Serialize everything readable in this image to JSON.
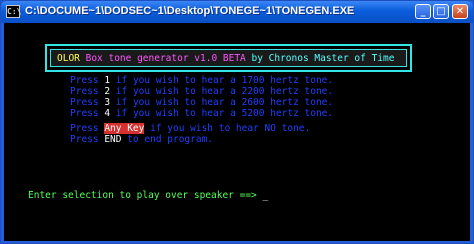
{
  "window": {
    "title": "C:\\DOCUME~1\\DODSEC~1\\Desktop\\TONEGE~1\\TONEGEN.EXE",
    "icon_label": "C:\\",
    "controls": {
      "minimize": "_",
      "maximize": "□",
      "close": "✕"
    }
  },
  "banner": {
    "part1": "OLOR",
    "part2": " Box tone generator v1.0 BETA",
    "part3": " by Chronos Master of Time"
  },
  "menu": [
    {
      "prefix": "Press ",
      "key": "1",
      "suffix": " if you wish to hear a 1700 hertz tone."
    },
    {
      "prefix": "Press ",
      "key": "2",
      "suffix": " if you wish to hear a 2200 hertz tone."
    },
    {
      "prefix": "Press ",
      "key": "3",
      "suffix": " if you wish to hear a 2600 hertz tone."
    },
    {
      "prefix": "Press ",
      "key": "4",
      "suffix": " if you wish to hear a 5200 hertz tone."
    }
  ],
  "no_tone": {
    "prefix": "Press ",
    "key": "Any Key",
    "suffix": " if you wish to hear NO tone."
  },
  "end": {
    "prefix": "Press ",
    "key": "END",
    "suffix": " to end program."
  },
  "prompt": {
    "text": "Enter selection to play over speaker ==> ",
    "cursor": "_"
  },
  "colors": {
    "titlebar": "#0a5ddc",
    "console_bg": "#000000",
    "banner_border": "#33e6e6",
    "menu_text": "#1f3fff",
    "prompt_text": "#55ff55",
    "highlight": "#d63030"
  }
}
